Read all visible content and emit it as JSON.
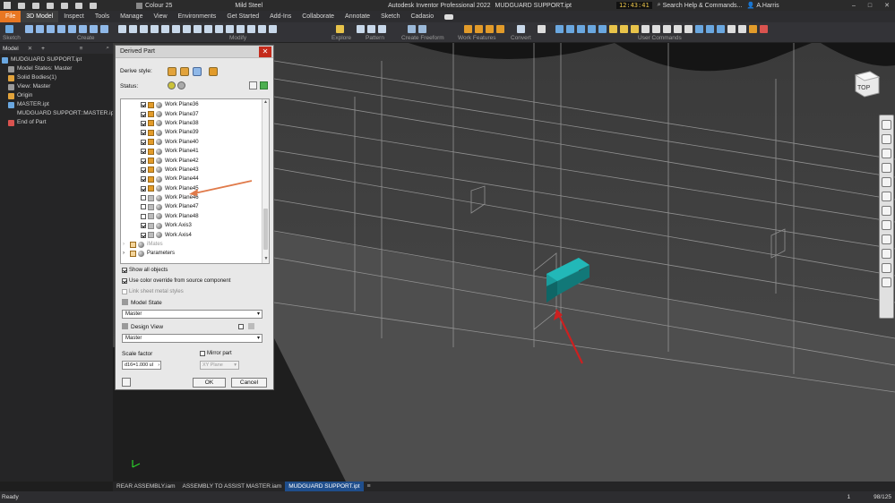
{
  "titlebar": {
    "appearance": "Colour 25",
    "material": "Mild Steel",
    "app_title": "Autodesk Inventor Professional 2022",
    "doc_title": "MUDGUARD SUPPORT.ipt",
    "search_placeholder": "Search Help & Commands...",
    "user": "A.Harris",
    "clock": "12:43:41"
  },
  "menu": [
    "File",
    "3D Model",
    "Inspect",
    "Tools",
    "Manage",
    "View",
    "Environments",
    "Get Started",
    "Add-Ins",
    "Collaborate",
    "Annotate",
    "Sketch",
    "Cadasio"
  ],
  "ribbon_groups": [
    "Sketch",
    "Create",
    "Modify",
    "Explore",
    "Pattern",
    "Create Freeform",
    "Work Features",
    "Convert",
    "User Commands"
  ],
  "browser": {
    "tab_model": "Model",
    "add": "+",
    "items": [
      {
        "label": "MUDGUARD SUPPORT.ipt",
        "indent": 0,
        "icon": "#6aa7e0"
      },
      {
        "label": "Model States: Master",
        "indent": 1,
        "icon": "#9a9a9a"
      },
      {
        "label": "Solid Bodies(1)",
        "indent": 1,
        "icon": "#e2a33b"
      },
      {
        "label": "View: Master",
        "indent": 1,
        "icon": "#9a9a9a"
      },
      {
        "label": "Origin",
        "indent": 1,
        "icon": "#e2a33b"
      },
      {
        "label": "MASTER.ipt",
        "indent": 1,
        "icon": "#6aa7e0"
      },
      {
        "label": "MUDGUARD SUPPORT::MASTER.ipt",
        "indent": 2,
        "icon": "#bbbbbb"
      },
      {
        "label": "End of Part",
        "indent": 1,
        "icon": "#d9534f"
      }
    ]
  },
  "dialog": {
    "title": "Derived Part",
    "close": "✕",
    "derive_style_label": "Derive style:",
    "status_label": "Status:",
    "tree_items": [
      {
        "label": "Work Plane36",
        "checked": true,
        "kind": "orange"
      },
      {
        "label": "Work Plane37",
        "checked": true,
        "kind": "orange"
      },
      {
        "label": "Work Plane38",
        "checked": true,
        "kind": "orange"
      },
      {
        "label": "Work Plane39",
        "checked": true,
        "kind": "orange"
      },
      {
        "label": "Work Plane40",
        "checked": true,
        "kind": "orange"
      },
      {
        "label": "Work Plane41",
        "checked": true,
        "kind": "orange"
      },
      {
        "label": "Work Plane42",
        "checked": true,
        "kind": "orange"
      },
      {
        "label": "Work Plane43",
        "checked": true,
        "kind": "orange"
      },
      {
        "label": "Work Plane44",
        "checked": true,
        "kind": "orange"
      },
      {
        "label": "Work Plane45",
        "checked": true,
        "kind": "orange"
      },
      {
        "label": "Work Plane46",
        "checked": false,
        "kind": "gray"
      },
      {
        "label": "Work Plane47",
        "checked": false,
        "kind": "gray"
      },
      {
        "label": "Work Plane48",
        "checked": false,
        "kind": "gray"
      },
      {
        "label": "Work Axis3",
        "checked": true,
        "kind": "gray"
      },
      {
        "label": "Work Axis4",
        "checked": true,
        "kind": "gray"
      }
    ],
    "mates_label": "iMates",
    "parameters_label": "Parameters",
    "show_all_objects": "Show all objects",
    "use_color_override": "Use color override from source component",
    "link_sheet_metal": "Link sheet metal styles",
    "model_state_label": "Model State",
    "model_state_value": "Master",
    "design_view_label": "Design View",
    "design_view_value": "Master",
    "scale_factor_label": "Scale factor",
    "scale_factor_value": "d16=1.000 ul",
    "mirror_part_label": "Mirror part",
    "mirror_plane_value": "XY Plane",
    "ok": "OK",
    "cancel": "Cancel"
  },
  "viewcube_label": "TOP",
  "doc_tabs": [
    "REAR ASSEMBLY.iam",
    "ASSEMBLY TO ASSIST MASTER.iam",
    "MUDGUARD SUPPORT.ipt"
  ],
  "status": {
    "text": "Ready",
    "count": "1",
    "page": "98/125"
  },
  "colors": {
    "accent": "#e87722",
    "part_highlight": "#1a9c9c",
    "annotation_arrow_orange": "#e07a4a",
    "annotation_arrow_red": "#cc2020"
  }
}
